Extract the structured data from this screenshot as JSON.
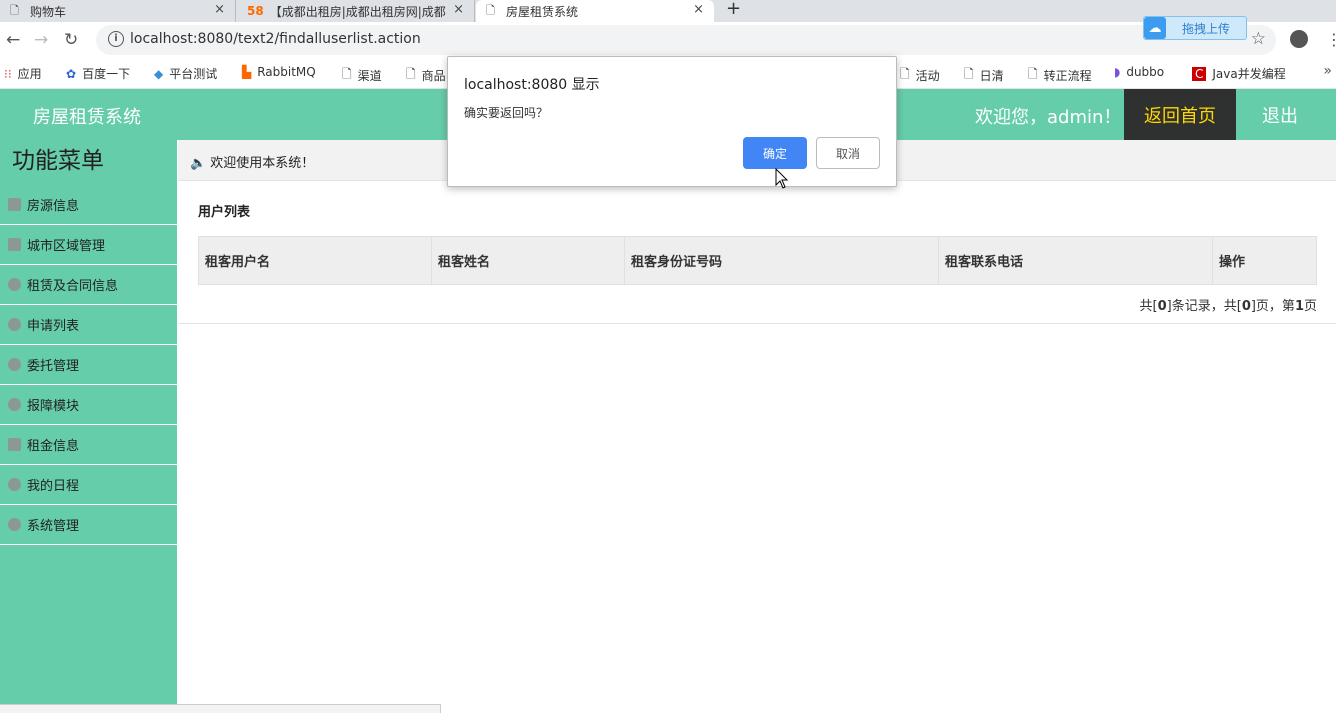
{
  "browser": {
    "tabs": [
      {
        "label": "购物车",
        "icon": "page-icon",
        "close": "×"
      },
      {
        "label": "【成都出租房|成都出租房网|成都",
        "icon": "58",
        "close": "×"
      },
      {
        "label": "房屋租赁系统",
        "icon": "page-icon",
        "close": "×"
      }
    ],
    "new_tab": "+",
    "url": "localhost:8080/text2/findalluserlist.action",
    "upload_button": "拖拽上传",
    "bookmarks": [
      {
        "label": "应用",
        "icon": "apps-grid-icon"
      },
      {
        "label": "百度一下",
        "icon": "baidu-paw-icon"
      },
      {
        "label": "平台测试",
        "icon": "diamond-icon"
      },
      {
        "label": "RabbitMQ",
        "icon": "rabbitmq-icon"
      },
      {
        "label": "渠道",
        "icon": "page-icon"
      },
      {
        "label": "商品",
        "icon": "page-icon"
      },
      {
        "label": "活动",
        "icon": "page-icon"
      },
      {
        "label": "日清",
        "icon": "page-icon"
      },
      {
        "label": "转正流程",
        "icon": "page-icon"
      },
      {
        "label": "dubbo",
        "icon": "dubbo-icon"
      },
      {
        "label": "Java并发编程",
        "icon": "csdn-icon"
      }
    ],
    "bookmarks_more": "»"
  },
  "header": {
    "title": "房屋租赁系统",
    "welcome": "欢迎您，admin！",
    "home": "返回首页",
    "logout": "退出"
  },
  "sidebar": {
    "title": "功能菜单",
    "items": [
      {
        "label": "房源信息",
        "icon": "user-card-icon"
      },
      {
        "label": "城市区域管理",
        "icon": "user-card-icon"
      },
      {
        "label": "租赁及合同信息",
        "icon": "gear-icon"
      },
      {
        "label": "申请列表",
        "icon": "gear-icon"
      },
      {
        "label": "委托管理",
        "icon": "gear-icon"
      },
      {
        "label": "报障模块",
        "icon": "gear-icon"
      },
      {
        "label": "租金信息",
        "icon": "user-card-icon"
      },
      {
        "label": "我的日程",
        "icon": "gear-icon"
      },
      {
        "label": "系统管理",
        "icon": "gear-icon"
      }
    ]
  },
  "notice": "欢迎使用本系统！",
  "main": {
    "list_title": "用户列表",
    "columns": [
      "租客用户名",
      "租客姓名",
      "租客身份证号码",
      "租客联系电话",
      "操作"
    ],
    "rows": [],
    "pager": {
      "pre": "共[",
      "records": "0",
      "mid1": "]条记录，共[",
      "pages": "0",
      "mid2": "]页，第",
      "current": "1",
      "post": "页"
    }
  },
  "dialog": {
    "title": "localhost:8080 显示",
    "message": "确实要返回吗？",
    "ok": "确定",
    "cancel": "取消"
  },
  "colors": {
    "header": "#66cdaa",
    "home_bg": "#2f3030",
    "home_text": "#ffd700",
    "ok_button": "#4285f4"
  }
}
